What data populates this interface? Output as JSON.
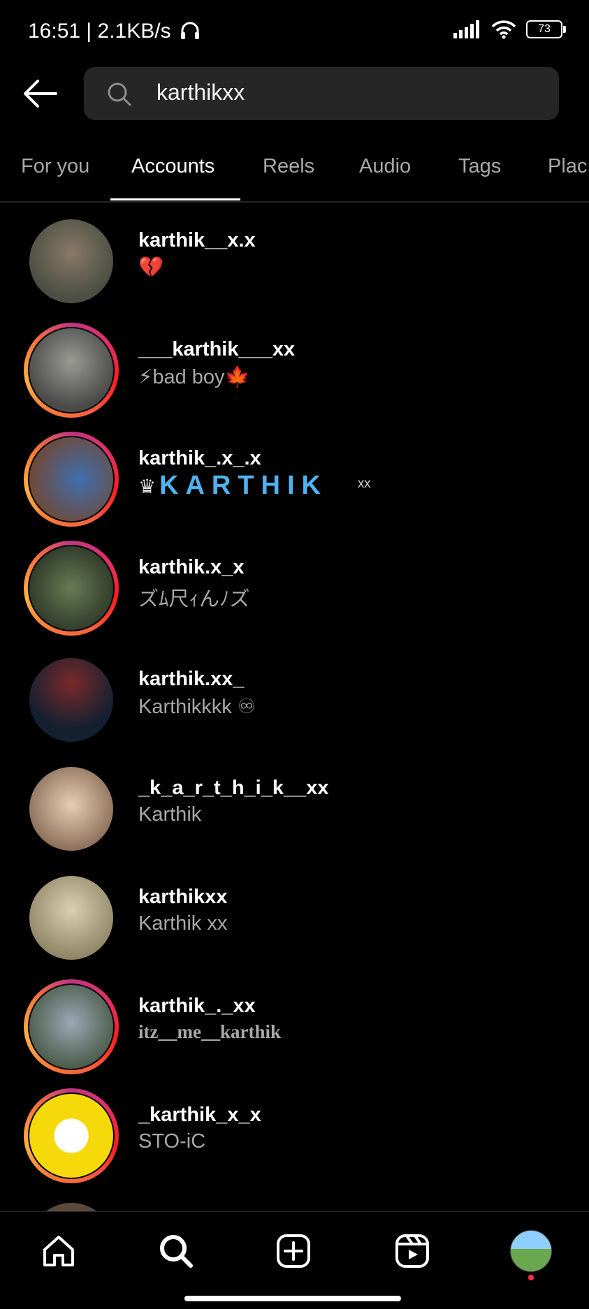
{
  "status": {
    "time": "16:51 | 2.1KB/s",
    "battery": "73"
  },
  "search": {
    "query": "karthikxx"
  },
  "tabs": [
    "For you",
    "Accounts",
    "Reels",
    "Audio",
    "Tags",
    "Plac"
  ],
  "active_tab": "Accounts",
  "results": [
    {
      "username": "karthik__x.x",
      "bio": "💔",
      "ring": false,
      "avatar_color": "#5a5e54"
    },
    {
      "username": "___karthik___xx",
      "bio": "⚡bad boy🍁",
      "ring": true,
      "avatar_color": "#6d6e6a"
    },
    {
      "username": "karthik_.x_.x",
      "bio": "KARTHIK",
      "bio_prefix": "♛",
      "bio_suffix": "ˣˣ",
      "ring": true,
      "avatar_color": "#3a5a86"
    },
    {
      "username": "karthik.x_x",
      "bio": "ズﾑ尺ｨんﾉズ",
      "ring": true,
      "avatar_color": "#4b5a40"
    },
    {
      "username": "karthik.xx_",
      "bio": "Karthikkkk ♾",
      "ring": false,
      "avatar_color": "#1c2a3a"
    },
    {
      "username": "_k_a_r_t_h_i_k__xx",
      "bio": "Karthik",
      "ring": false,
      "avatar_color": "#c9b7a4"
    },
    {
      "username": "karthikxx",
      "bio": "Karthik  xx",
      "ring": false,
      "avatar_color": "#b0a27c"
    },
    {
      "username": "karthik_._xx",
      "bio": "itz__me__karthik",
      "ring": true,
      "avatar_color": "#6b7b8a"
    },
    {
      "username": "_karthik_x_x",
      "bio": "STO-iC",
      "ring": true,
      "avatar_color": "#f5d90a"
    }
  ],
  "nav": {
    "home": "home-icon",
    "search": "search-icon",
    "create": "plus-square-icon",
    "reels": "reels-icon",
    "profile": "profile-avatar"
  }
}
